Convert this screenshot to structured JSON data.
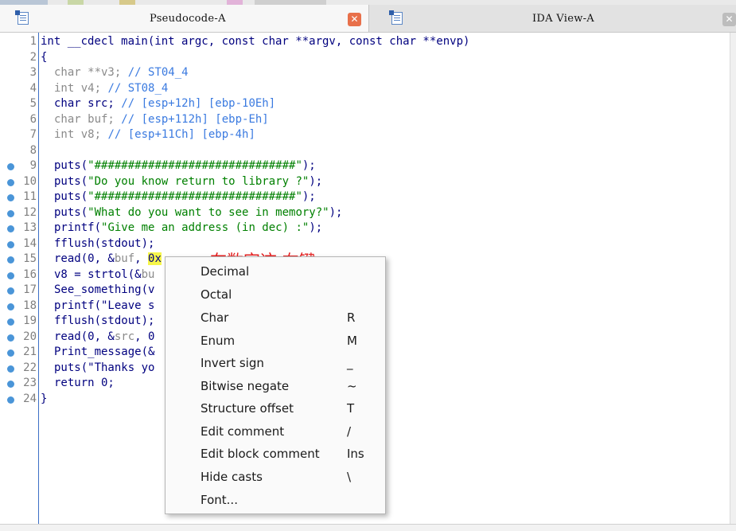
{
  "colors": {
    "accent_blue": "#3d6fc6",
    "code_keyword": "#00007f",
    "comment": "#3a7ae0",
    "string": "#008000",
    "highlight": "#f6f64a",
    "annotation_red": "#e62020",
    "close_active": "#e8704a"
  },
  "tabs": [
    {
      "title": "Pseudocode-A",
      "icon": "pseudocode-icon",
      "close_icon": "close-icon"
    },
    {
      "title": "IDA View-A",
      "icon": "disassembly-icon",
      "close_icon": "close-icon"
    }
  ],
  "code": {
    "lines": [
      {
        "num": "1",
        "decl": false,
        "marker": false
      },
      {
        "num": "2",
        "decl": false,
        "marker": false
      },
      {
        "num": "3",
        "decl": true,
        "marker": false
      },
      {
        "num": "4",
        "decl": true,
        "marker": false
      },
      {
        "num": "5",
        "decl": true,
        "marker": false
      },
      {
        "num": "6",
        "decl": true,
        "marker": false
      },
      {
        "num": "7",
        "decl": true,
        "marker": false
      },
      {
        "num": "8",
        "decl": false,
        "marker": false
      },
      {
        "num": "9",
        "decl": false,
        "marker": true
      },
      {
        "num": "10",
        "decl": false,
        "marker": true
      },
      {
        "num": "11",
        "decl": false,
        "marker": true
      },
      {
        "num": "12",
        "decl": false,
        "marker": true
      },
      {
        "num": "13",
        "decl": false,
        "marker": true
      },
      {
        "num": "14",
        "decl": false,
        "marker": true
      },
      {
        "num": "15",
        "decl": false,
        "marker": true
      },
      {
        "num": "16",
        "decl": false,
        "marker": true
      },
      {
        "num": "17",
        "decl": false,
        "marker": true
      },
      {
        "num": "18",
        "decl": false,
        "marker": true
      },
      {
        "num": "19",
        "decl": false,
        "marker": true
      },
      {
        "num": "20",
        "decl": false,
        "marker": true
      },
      {
        "num": "21",
        "decl": false,
        "marker": true
      },
      {
        "num": "22",
        "decl": false,
        "marker": true
      },
      {
        "num": "23",
        "decl": false,
        "marker": true
      },
      {
        "num": "24",
        "decl": false,
        "marker": true
      }
    ],
    "l1": "int __cdecl main(int argc, const char **argv, const char **envp)",
    "l2": "{",
    "l3_a": "char **v3; ",
    "l3_c": "// ST04_4",
    "l4_a": "int v4; ",
    "l4_c": "// ST08_4",
    "l5_a": "char src; ",
    "l5_c": "// [esp+12h] [ebp-10Eh]",
    "l6_a": "char buf; ",
    "l6_c": "// [esp+112h] [ebp-Eh]",
    "l7_a": "int v8; ",
    "l7_c": "// [esp+11Ch] [ebp-4h]",
    "l9_a": "puts(",
    "l9_s": "\"##############################\"",
    "l9_b": ");",
    "l10_a": "puts(",
    "l10_s": "\"Do you know return to library ?\"",
    "l10_b": ");",
    "l11_a": "puts(",
    "l11_s": "\"##############################\"",
    "l11_b": ");",
    "l12_a": "puts(",
    "l12_s": "\"What do you want to see in memory?\"",
    "l12_b": ");",
    "l13_a": "printf(",
    "l13_s": "\"Give me an address (in dec) :\"",
    "l13_b": ");",
    "l14": "fflush(stdout);",
    "l15_a": "read(0, &",
    "l15_v": "buf",
    "l15_b": ", ",
    "l15_h": "0x",
    "l16_a": "v8 = strtol(&",
    "l16_v": "bu",
    "l17": "See_something(v",
    "l18": "printf(\"Leave s",
    "l19": "fflush(stdout);",
    "l20_a": "read(0, &",
    "l20_v": "src",
    "l20_b": ", 0",
    "l21": "Print_message(&",
    "l22": "puts(\"Thanks yo",
    "l23": "return 0;",
    "l24": "}"
  },
  "annotation": "在数字这 右键",
  "context_menu": {
    "items": [
      {
        "label": "Decimal",
        "shortcut": ""
      },
      {
        "label": "Octal",
        "shortcut": ""
      },
      {
        "label": "Char",
        "shortcut": "R"
      },
      {
        "label": "Enum",
        "shortcut": "M"
      },
      {
        "label": "Invert sign",
        "shortcut": "_"
      },
      {
        "label": "Bitwise negate",
        "shortcut": "~"
      },
      {
        "label": "Structure offset",
        "shortcut": "T"
      },
      {
        "label": "Edit comment",
        "shortcut": "/"
      },
      {
        "label": "Edit block comment",
        "shortcut": "Ins"
      },
      {
        "label": "Hide casts",
        "shortcut": "\\"
      },
      {
        "label": "Font...",
        "shortcut": ""
      }
    ]
  }
}
